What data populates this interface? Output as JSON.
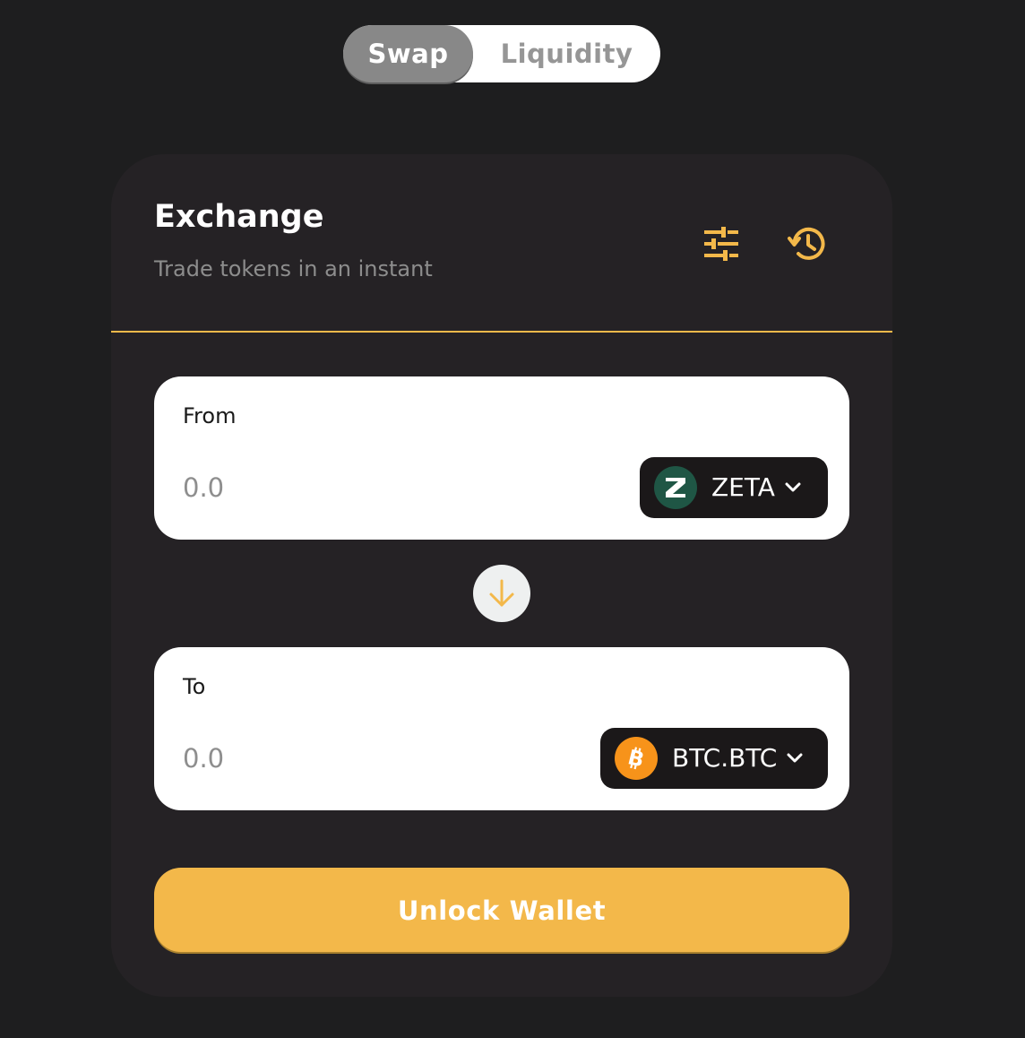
{
  "tabs": {
    "swap": "Swap",
    "liquidity": "Liquidity",
    "active": "swap"
  },
  "exchange": {
    "title": "Exchange",
    "subtitle": "Trade tokens in an instant",
    "icons": [
      "settings-sliders-icon",
      "history-icon"
    ]
  },
  "from": {
    "label": "From",
    "amount_placeholder": "0.0",
    "token": {
      "symbol": "ZETA",
      "icon": "zeta-logo-icon",
      "color": "#1f5645"
    }
  },
  "to": {
    "label": "To",
    "amount_placeholder": "0.0",
    "token": {
      "symbol": "BTC.BTC",
      "icon": "bitcoin-logo-icon",
      "color": "#f7931a"
    }
  },
  "switch_icon": "arrow-down-icon",
  "unlock_wallet_label": "Unlock Wallet",
  "colors": {
    "accent": "#f3b84a",
    "background": "#1e1e1f",
    "card": "#252225",
    "token_select_bg": "#1b1819"
  }
}
